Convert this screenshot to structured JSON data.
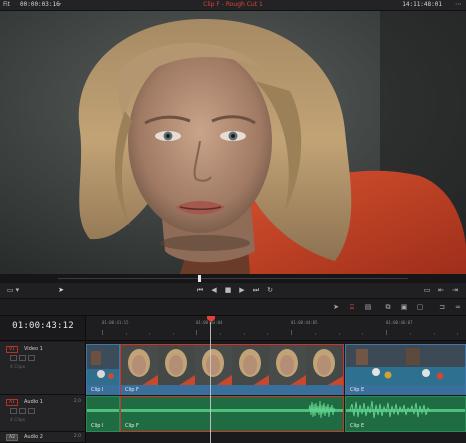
{
  "topbar": {
    "zoom": "Fit",
    "timecode_left": "00:00:03:16",
    "clip_title": "Clip F - Rough Cut 1",
    "timecode_right": "14:11:48:01"
  },
  "timeline": {
    "timecode": "01:00:43:12",
    "ruler_labels": [
      "01:00:41:15",
      "01:00:43:04",
      "01:00:44:05",
      "01:00:46:07"
    ],
    "tracks": [
      {
        "tag": "V1",
        "name": "Video 1",
        "count": "4 Clips"
      },
      {
        "tag": "A1",
        "name": "Audio 1",
        "level": "2.0",
        "count": "4 Clips"
      },
      {
        "tag": "A2",
        "name": "Audio 2",
        "level": "2.0"
      }
    ],
    "clips": {
      "video": [
        "Clip I",
        "Clip F",
        "Clip E"
      ],
      "audio": [
        "Clip I",
        "Clip F",
        "Clip E"
      ]
    }
  },
  "colors": {
    "accent": "#e0423a",
    "video_clip": "#3a6f9c",
    "audio_clip": "#1f6c43"
  },
  "icons": {
    "transport": [
      "go-to-start-icon",
      "step-back-icon",
      "stop-icon",
      "play-icon",
      "go-to-end-icon",
      "loop-icon"
    ],
    "tools": [
      "selection-icon",
      "trim-icon",
      "blade-icon",
      "insert-icon",
      "overwrite-icon",
      "replace-icon",
      "append-icon",
      "place-on-top-icon",
      "snapping-icon",
      "linked-selection-icon"
    ]
  }
}
